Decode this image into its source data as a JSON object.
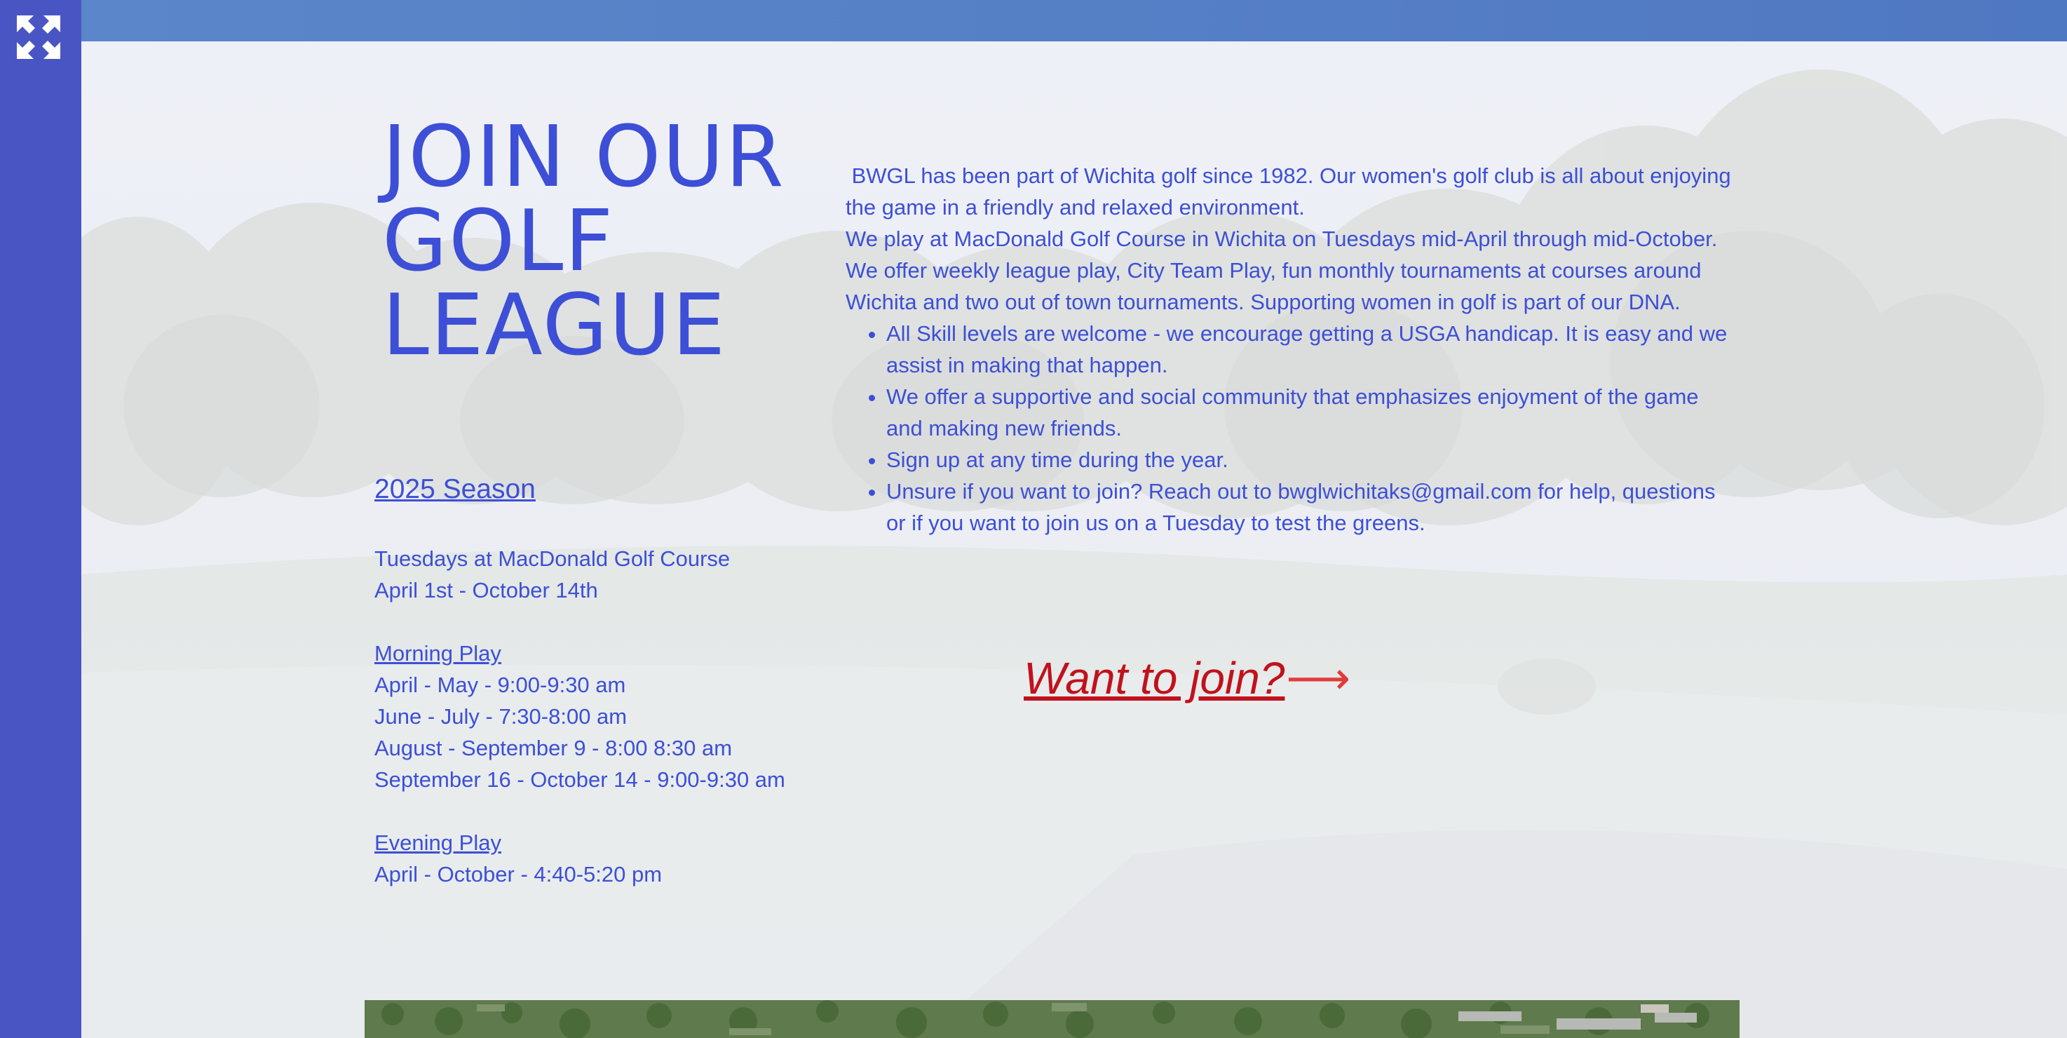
{
  "colors": {
    "sidebar": "#4a55c4",
    "top_band": "#5680c6",
    "text_blue": "#3d4fd6",
    "link_red": "#c1121c"
  },
  "sidebar": {
    "expand_icon": "expand-arrows-icon"
  },
  "hero": {
    "title_lines": [
      "JOIN OUR",
      "GOLF",
      "LEAGUE"
    ]
  },
  "intro": {
    "paragraph1": " BWGL has been part of Wichita golf since 1982. Our women's golf club is all about enjoying the game in a friendly and relaxed environment.",
    "paragraph2": "We play at MacDonald Golf Course in Wichita on Tuesdays mid-April through mid-October.  We offer weekly league play, City Team Play, fun monthly tournaments at courses around Wichita and two out of town tournaments.  Supporting women in golf is part of our DNA.",
    "bullets": [
      "All Skill levels are welcome - we encourage getting a USGA handicap. It is easy and we assist in making that happen.",
      "We offer a supportive and social community that emphasizes enjoyment of the game and making new friends.",
      "Sign up at any time during the year.",
      "Unsure if you want to join?  Reach out to bwglwichitaks@gmail.com for help, questions or if you want to join us on a Tuesday to test the greens."
    ]
  },
  "schedule": {
    "season_title": "2025 Season",
    "course_line": "Tuesdays at MacDonald Golf Course",
    "date_range": "April 1st - October 14th",
    "morning_title": "Morning Play",
    "morning_items": [
      "April - May - 9:00-9:30 am",
      "June - July - 7:30-8:00 am",
      "August - September 9 - 8:00 8:30 am",
      "September 16 - October 14 - 9:00-9:30 am"
    ],
    "evening_title": "Evening Play",
    "evening_items": [
      "April - October - 4:40-5:20 pm"
    ]
  },
  "cta": {
    "label": "Want to join?",
    "arrow": "⟶"
  }
}
